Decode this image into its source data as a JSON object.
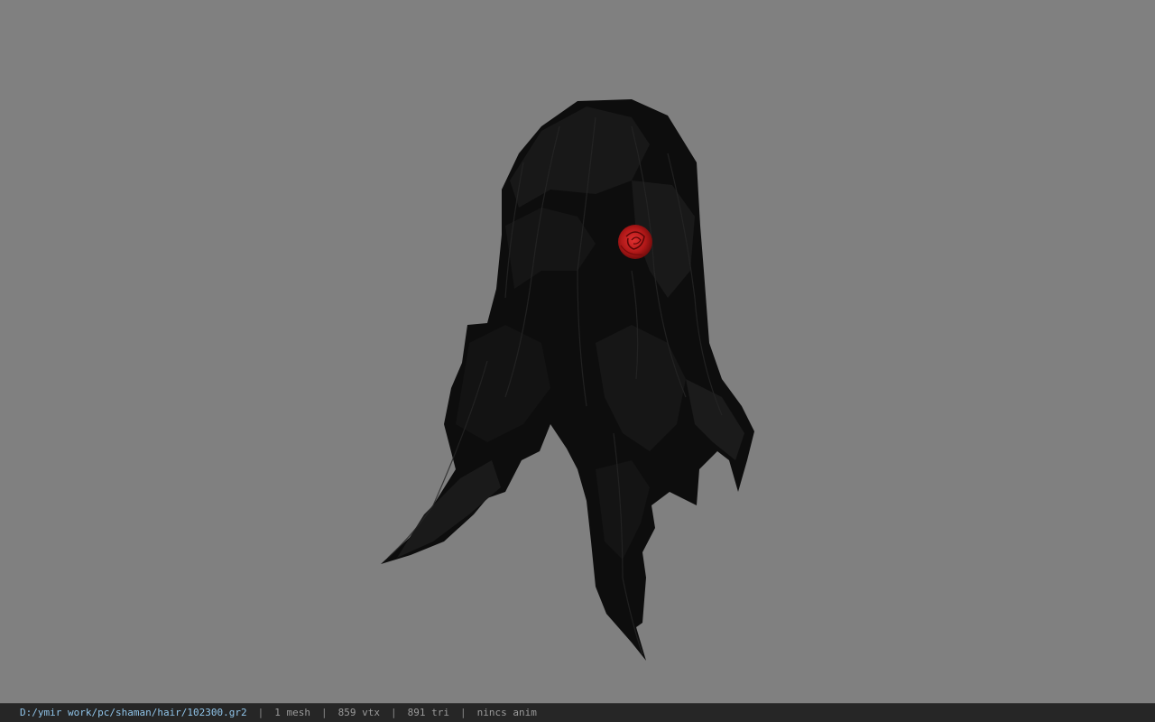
{
  "viewer": {
    "background_color": "#808080",
    "model_name": "long black hair with red rose",
    "hair_color": "#0c0c0c",
    "accent_color": "#b01818"
  },
  "status_bar": {
    "path": "D:/ymir work/pc/shaman/hair/102300.gr2",
    "mesh_count": "1 mesh",
    "vertex_count": "859 vtx",
    "triangle_count": "891 tri",
    "anim": "nincs anim",
    "separator": "|"
  }
}
